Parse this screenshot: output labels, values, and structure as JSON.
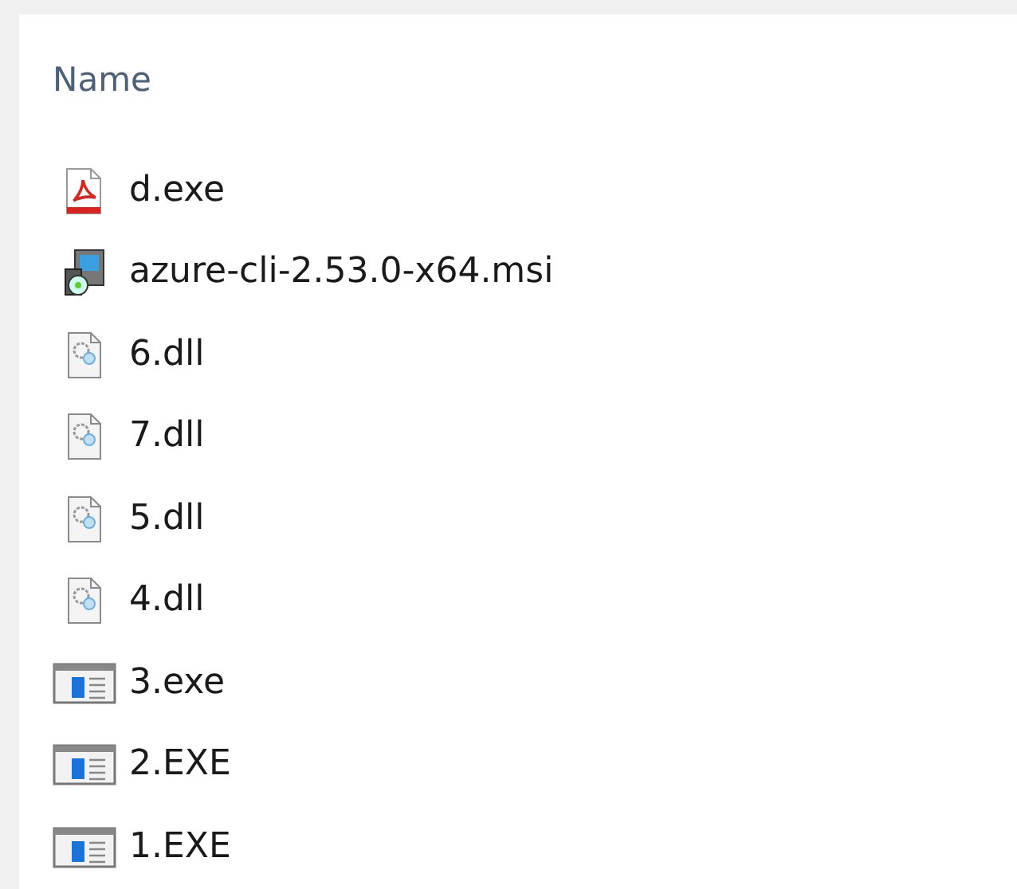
{
  "column_header": "Name",
  "files": [
    {
      "name": "d.exe",
      "kind": "pdf"
    },
    {
      "name": "azure-cli-2.53.0-x64.msi",
      "kind": "installer"
    },
    {
      "name": "6.dll",
      "kind": "dll"
    },
    {
      "name": "7.dll",
      "kind": "dll"
    },
    {
      "name": "5.dll",
      "kind": "dll"
    },
    {
      "name": "4.dll",
      "kind": "dll"
    },
    {
      "name": "3.exe",
      "kind": "exe"
    },
    {
      "name": "2.EXE",
      "kind": "exe"
    },
    {
      "name": "1.EXE",
      "kind": "exe"
    }
  ]
}
